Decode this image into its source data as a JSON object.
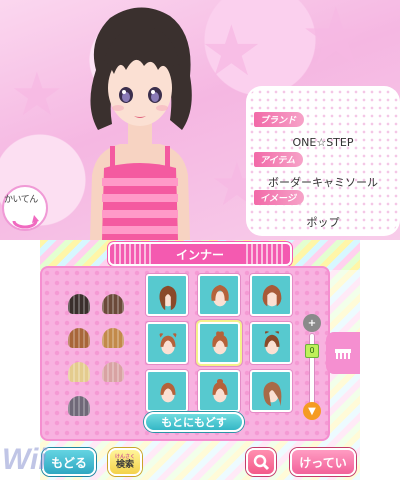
{
  "top": {
    "rotate_label": "かいてん",
    "info": {
      "brand_header": "ブランド",
      "brand_value": "ONE☆STEP",
      "item_header": "アイテム",
      "item_value": "ボーダーキャミソール",
      "image_header": "イメージ",
      "image_value": "ポップ"
    }
  },
  "bottom": {
    "category_title": "インナー",
    "reset_label": "もとにもどす",
    "back_label": "もどる",
    "search_ruby": "けんさく",
    "search_label": "検索",
    "decide_label": "けってい",
    "zoom_level": "0",
    "hair_colors": [
      {
        "name": "black",
        "color": "#3a2f2c",
        "selected": true
      },
      {
        "name": "dark-brown",
        "color": "#6b4a3a",
        "selected": false
      },
      {
        "name": "brown",
        "color": "#a8663a",
        "selected": false
      },
      {
        "name": "light-brown",
        "color": "#c28a4a",
        "selected": false
      },
      {
        "name": "blonde",
        "color": "#e4cc8e",
        "selected": false
      },
      {
        "name": "pink-beige",
        "color": "#d8a3a3",
        "selected": false
      },
      {
        "name": "ash-gray",
        "color": "#6f6878",
        "selected": false
      }
    ],
    "hair_styles": [
      "style-1",
      "style-2",
      "style-3",
      "style-4",
      "style-5",
      "style-6",
      "style-7",
      "style-8",
      "style-9"
    ]
  },
  "watermark": "Wii"
}
